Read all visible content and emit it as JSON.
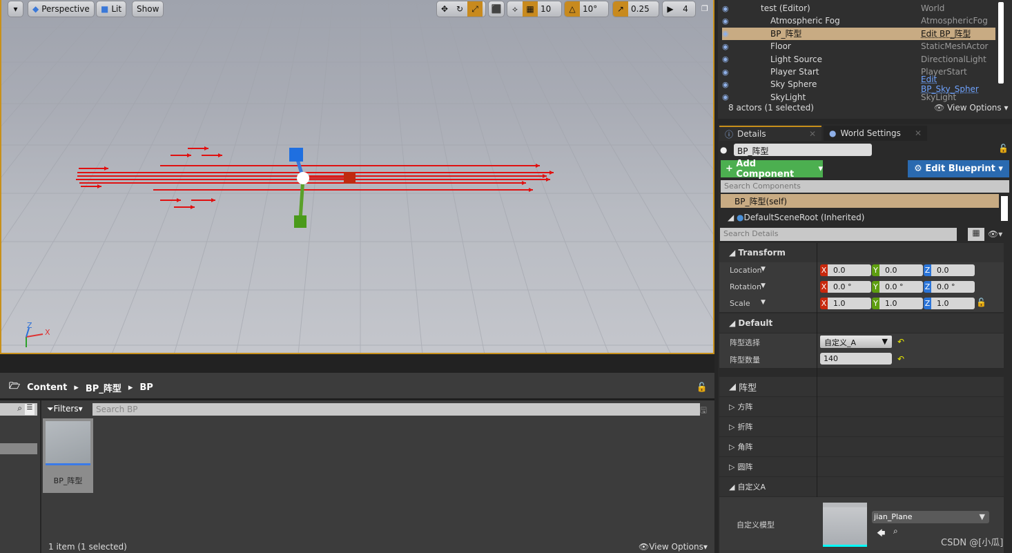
{
  "viewport": {
    "perspective": "Perspective",
    "lit": "Lit",
    "show": "Show",
    "grid_snap": "10",
    "rot_snap": "10°",
    "scale_snap": "0.25",
    "cam_speed": "4",
    "axis_x": "X",
    "axis_z": "Z"
  },
  "outliner": {
    "rows": [
      {
        "name": "test (Editor)",
        "type": "World"
      },
      {
        "name": "Atmospheric Fog",
        "type": "AtmosphericFog"
      },
      {
        "name": "BP_阵型",
        "type": "Edit BP_阵型"
      },
      {
        "name": "Floor",
        "type": "StaticMeshActor"
      },
      {
        "name": "Light Source",
        "type": "DirectionalLight"
      },
      {
        "name": "Player Start",
        "type": "PlayerStart"
      },
      {
        "name": "Sky Sphere",
        "type": "Edit BP_Sky_Spher"
      },
      {
        "name": "SkyLight",
        "type": "SkyLight"
      }
    ],
    "status": "8 actors (1 selected)",
    "view_options": "View Options"
  },
  "details": {
    "tab_details": "Details",
    "tab_world": "World Settings",
    "actor_name": "BP_阵型",
    "add_component": "Add Component",
    "edit_blueprint": "Edit Blueprint",
    "search_components": "Search Components",
    "self": "BP_阵型(self)",
    "root": "DefaultSceneRoot (Inherited)",
    "search_details": "Search Details",
    "transform": {
      "title": "Transform",
      "location": {
        "label": "Location",
        "x": "0.0",
        "y": "0.0",
        "z": "0.0"
      },
      "rotation": {
        "label": "Rotation",
        "x": "0.0 °",
        "y": "0.0 °",
        "z": "0.0 °"
      },
      "scale": {
        "label": "Scale",
        "x": "1.0",
        "y": "1.0",
        "z": "1.0"
      }
    },
    "default": {
      "title": "Default",
      "select_label": "阵型选择",
      "select_value": "自定义_A",
      "count_label": "阵型数量",
      "count_value": "140"
    },
    "formation": {
      "title": "阵型",
      "items": [
        "方阵",
        "折阵",
        "角阵",
        "圆阵",
        "自定义A"
      ],
      "model_label": "自定义模型",
      "model_value": "jian_Plane"
    }
  },
  "content_browser": {
    "crumbs": [
      "Content",
      "BP_阵型",
      "BP"
    ],
    "filters": "Filters",
    "search_placeholder": "Search BP",
    "asset": "BP_阵型",
    "status": "1 item (1 selected)",
    "view_options": "View Options"
  },
  "watermark": "CSDN @[小瓜]"
}
